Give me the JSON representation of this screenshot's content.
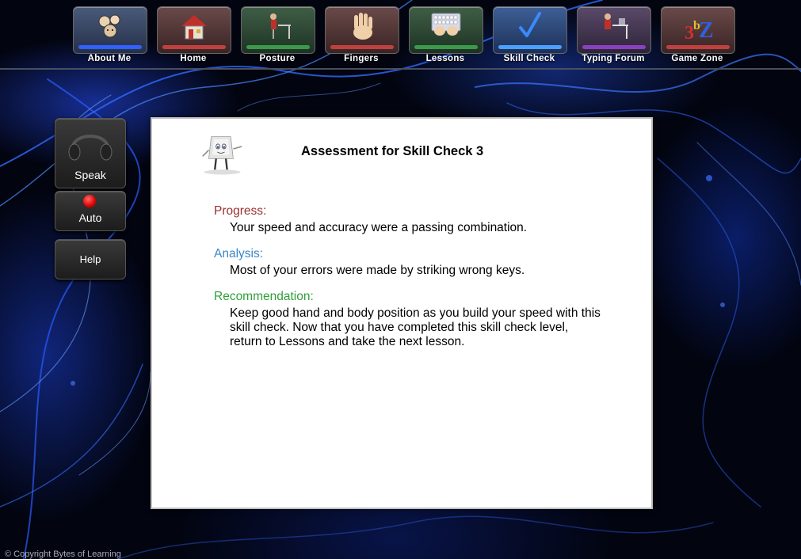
{
  "nav": {
    "items": [
      {
        "label": "About Me",
        "color": "#3a4a6a",
        "bar": "#3060ff"
      },
      {
        "label": "Home",
        "color": "#5a3a3a",
        "bar": "#c04040"
      },
      {
        "label": "Posture",
        "color": "#2f4a36",
        "bar": "#3a9a4a"
      },
      {
        "label": "Fingers",
        "color": "#5a3a3a",
        "bar": "#c04040"
      },
      {
        "label": "Lessons",
        "color": "#2f4a36",
        "bar": "#3a9a4a"
      },
      {
        "label": "Skill Check",
        "color": "#2e4d7a",
        "bar": "#4aa0ff"
      },
      {
        "label": "Typing Forum",
        "color": "#4a3858",
        "bar": "#8a40c0"
      },
      {
        "label": "Game Zone",
        "color": "#5a3a3a",
        "bar": "#c04040"
      }
    ]
  },
  "sidebar": {
    "speak_label": "Speak",
    "auto_label": "Auto",
    "help_label": "Help"
  },
  "panel": {
    "title": "Assessment for Skill Check 3",
    "progress_heading": "Progress:",
    "progress_text": "Your speed and accuracy were a passing combination.",
    "analysis_heading": "Analysis:",
    "analysis_text": "Most of your errors were made by striking wrong keys.",
    "recommendation_heading": "Recommendation:",
    "recommendation_text": "Keep good hand and body position as you build your speed with this skill check. Now that you have completed this skill check level, return to Lessons and take the next lesson.",
    "colors": {
      "progress": "#9b3030",
      "analysis": "#3a86c8",
      "recommendation": "#2ea03a"
    }
  },
  "footer": "© Copyright Bytes of Learning"
}
